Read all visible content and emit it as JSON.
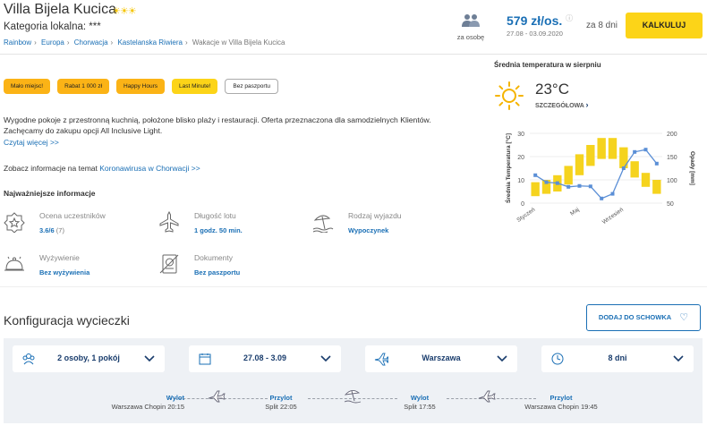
{
  "header": {
    "title": "Villa Bijela Kucica",
    "stars": "☀☀☀",
    "category": "Kategoria lokalna: ***",
    "breadcrumb": [
      "Rainbow",
      "Europa",
      "Chorwacja",
      "Kastelanska Riwiera",
      "Wakacje w Villa Bijela Kucica"
    ],
    "persons_label": "za osobę",
    "price": "579 zł/os.",
    "price_info": "ⓘ",
    "dates": "27.08 - 03.09.2020",
    "days": "za 8 dni",
    "calc_button": "KALKULUJ"
  },
  "tags": [
    {
      "label": "Mało miejsc!",
      "style": "orange"
    },
    {
      "label": "Rabat 1 000 zł",
      "style": "orange"
    },
    {
      "label": "Happy Hours",
      "style": "orange"
    },
    {
      "label": "Last Minute!",
      "style": "yellow"
    },
    {
      "label": "Bez paszportu",
      "style": "outline"
    }
  ],
  "description": "Wygodne pokoje z przestronną kuchnią, położone blisko plaży i restauracji. Oferta przeznaczona dla samodzielnych Klientów. Zachęcamy do zakupu opcji All Inclusive Light.",
  "read_more": "Czytaj więcej >>",
  "covid_prefix": "Zobacz informacje na temat ",
  "covid_link": "Koronawirusa w Chorwacji >>",
  "key_info_title": "Najważniejsze informacje",
  "key_info": {
    "rating": {
      "label": "Ocena uczestników",
      "value": "3.6/6",
      "sub": "(7)",
      "icon": "star-badge-icon"
    },
    "flight": {
      "label": "Długość lotu",
      "value": "1 godz. 50 min.",
      "icon": "airplane-icon"
    },
    "trip": {
      "label": "Rodzaj wyjazdu",
      "value": "Wypoczynek",
      "icon": "beach-umbrella-icon"
    },
    "food": {
      "label": "Wyżywienie",
      "value": "Bez wyżywienia",
      "icon": "food-cloche-icon"
    },
    "docs": {
      "label": "Dokumenty",
      "value": "Bez paszportu",
      "icon": "passport-icon"
    }
  },
  "weather": {
    "title": "Średnia temperatura w sierpniu",
    "temperature": "23°C",
    "details": "SZCZEGÓŁOWA",
    "icon": "sun-icon"
  },
  "chart_data": {
    "type": "bar",
    "title": "",
    "categories": [
      "Styczeń",
      "Luty",
      "Marzec",
      "Kwiecień",
      "Maj",
      "Czerwiec",
      "Lipiec",
      "Sierpień",
      "Wrzesień",
      "Październik",
      "Listopad",
      "Grudzień"
    ],
    "x_tick_labels": [
      "Styczeń",
      "Maj",
      "Wrzesień"
    ],
    "ylabel_left": "Średnia Temperatura [°C]",
    "ylabel_right": "Opady [mm]",
    "ylim_left": [
      0,
      30
    ],
    "ylim_right": [
      50,
      200
    ],
    "yticks_left": [
      0,
      10,
      20,
      30
    ],
    "yticks_right": [
      50,
      100,
      150,
      200
    ],
    "temp_ranges": [
      [
        3,
        9
      ],
      [
        4,
        10
      ],
      [
        5,
        12
      ],
      [
        8,
        16
      ],
      [
        12,
        21
      ],
      [
        16,
        25
      ],
      [
        19,
        28
      ],
      [
        19,
        28
      ],
      [
        15,
        24
      ],
      [
        11,
        18
      ],
      [
        7,
        13
      ],
      [
        4,
        10
      ]
    ],
    "precipitation": [
      110,
      95,
      93,
      85,
      87,
      86,
      60,
      70,
      125,
      160,
      165,
      135
    ],
    "bar_color": "#f5d31e",
    "line_color": "#5b8fd6"
  },
  "config": {
    "title": "Konfiguracja wycieczki",
    "add_button": "DODAJ DO SCHOWKA",
    "selectors": [
      {
        "text": "2 osoby, 1 pokój",
        "icon": "people-icon"
      },
      {
        "text": "27.08 - 3.09",
        "icon": "calendar-icon"
      },
      {
        "text": "Warszawa",
        "icon": "airplane-icon"
      },
      {
        "text": "8 dni",
        "icon": "clock-icon"
      }
    ],
    "flights": [
      {
        "type": "Wylot",
        "info": "Warszawa Chopin 20:15"
      },
      {
        "type": "Przylot",
        "info": "Split 22:05"
      },
      {
        "type": "Wylot",
        "info": "Split 17:55"
      },
      {
        "type": "Przylot",
        "info": "Warszawa Chopin 19:45"
      }
    ]
  }
}
